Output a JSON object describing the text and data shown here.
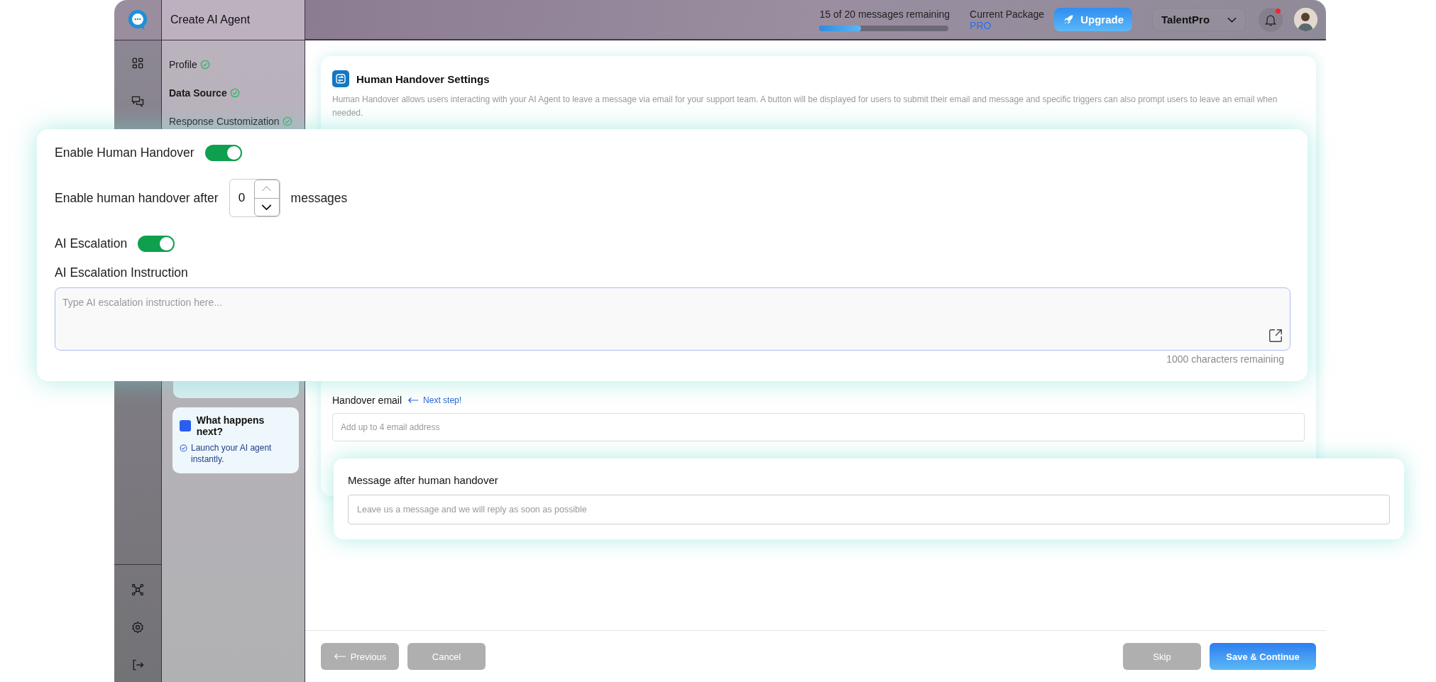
{
  "app": {
    "title": "Create AI Agent"
  },
  "top_bar": {
    "usage": {
      "text": "15 of 20 messages remaining",
      "level": 0.32
    },
    "package": {
      "label": "Current Package",
      "value": "PRO"
    },
    "upgrade_button": "Upgrade",
    "workspace": "TalentPro",
    "notifications": {
      "unread": true
    }
  },
  "steps": [
    {
      "label": "Profile",
      "done": true,
      "selected": false
    },
    {
      "label": "Data Source",
      "done": true,
      "selected": true
    },
    {
      "label": "Response Customization",
      "done": true,
      "selected": false
    }
  ],
  "next_card": {
    "title": "What happens next?",
    "items": [
      "Launch your AI agent instantly."
    ]
  },
  "settings_card": {
    "title": "Human Handover Settings",
    "description": "Human Handover allows users interacting with your AI Agent to leave a message via email for your support team. A button will be displayed for users to submit their email and message and specific triggers can also prompt users to leave an email when needed.",
    "handover_email": {
      "label": "Handover email",
      "hint": "Next step!",
      "placeholder": "Add up to 4 email address"
    }
  },
  "handover_panel": {
    "enable": {
      "label": "Enable Human Handover",
      "on": true
    },
    "after": {
      "prefix": "Enable human handover after",
      "value": "0",
      "suffix": "messages"
    },
    "escalation": {
      "label": "AI Escalation",
      "on": true
    },
    "instruction": {
      "label": "AI Escalation Instruction",
      "placeholder": "Type AI escalation instruction here...",
      "counter": "1000 characters remaining"
    }
  },
  "message_panel": {
    "label": "Message after human handover",
    "placeholder": "Leave us a message and we will reply as soon as possible"
  },
  "footer": {
    "left_buttons": [
      {
        "label": "Previous",
        "kind": "back",
        "disabled": true
      },
      {
        "label": "Cancel",
        "kind": "plain",
        "disabled": true
      }
    ],
    "right_buttons": [
      {
        "label": "Skip",
        "kind": "plain",
        "disabled": true
      },
      {
        "label": "Save & Continue",
        "kind": "primary",
        "disabled": false
      }
    ]
  }
}
